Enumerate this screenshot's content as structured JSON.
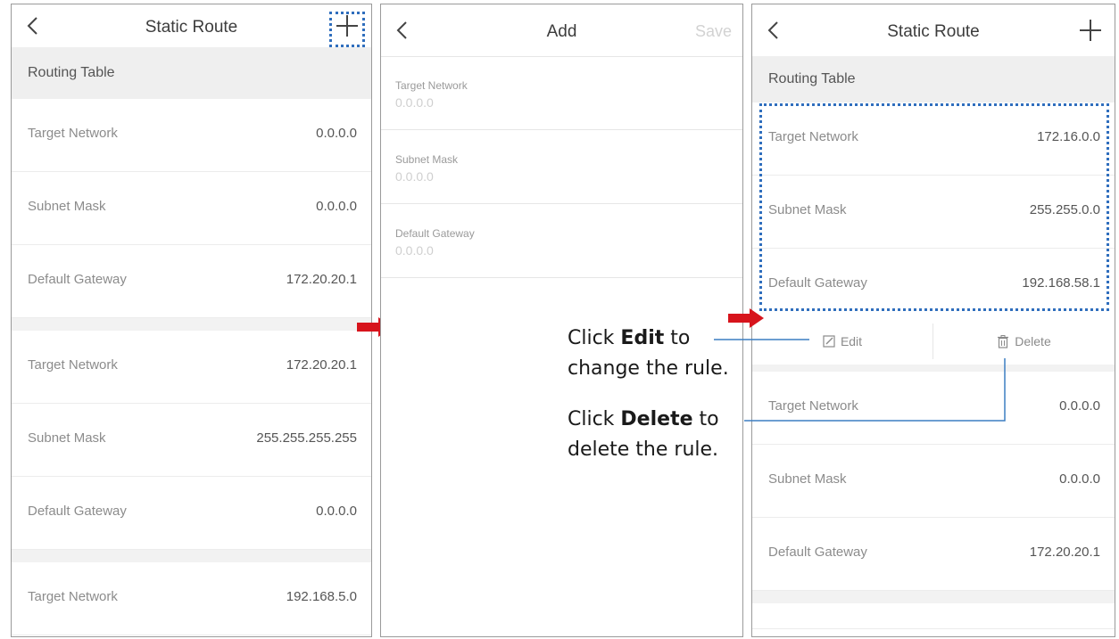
{
  "panel1": {
    "header": {
      "title": "Static Route"
    },
    "section_label": "Routing Table",
    "groups": [
      {
        "rows": [
          {
            "label": "Target Network",
            "value": "0.0.0.0"
          },
          {
            "label": "Subnet Mask",
            "value": "0.0.0.0"
          },
          {
            "label": "Default Gateway",
            "value": "172.20.20.1"
          }
        ]
      },
      {
        "rows": [
          {
            "label": "Target Network",
            "value": "172.20.20.1"
          },
          {
            "label": "Subnet Mask",
            "value": "255.255.255.255"
          },
          {
            "label": "Default Gateway",
            "value": "0.0.0.0"
          }
        ]
      },
      {
        "rows": [
          {
            "label": "Target Network",
            "value": "192.168.5.0"
          }
        ]
      }
    ]
  },
  "panel2": {
    "header": {
      "title": "Add",
      "save_label": "Save"
    },
    "fields": [
      {
        "label": "Target Network",
        "placeholder": "0.0.0.0"
      },
      {
        "label": "Subnet Mask",
        "placeholder": "0.0.0.0"
      },
      {
        "label": "Default Gateway",
        "placeholder": "0.0.0.0"
      }
    ]
  },
  "panel3": {
    "header": {
      "title": "Static Route"
    },
    "section_label": "Routing Table",
    "selected_rows": [
      {
        "label": "Target Network",
        "value": "172.16.0.0"
      },
      {
        "label": "Subnet Mask",
        "value": "255.255.0.0"
      },
      {
        "label": "Default Gateway",
        "value": "192.168.58.1"
      }
    ],
    "actions": {
      "edit_label": "Edit",
      "delete_label": "Delete"
    },
    "rows": [
      {
        "label": "Target Network",
        "value": "0.0.0.0"
      },
      {
        "label": "Subnet Mask",
        "value": "0.0.0.0"
      },
      {
        "label": "Default Gateway",
        "value": "172.20.20.1"
      }
    ]
  },
  "annotations": {
    "edit": {
      "pre": "Click ",
      "bold": "Edit",
      "post": " to",
      "line2": "change the rule."
    },
    "delete": {
      "pre": "Click ",
      "bold": "Delete",
      "post": " to",
      "line2": "delete the rule."
    }
  },
  "colors": {
    "highlight": "#2f6ebd",
    "arrow": "#d7141c",
    "callout_line": "#3c7ec2"
  }
}
